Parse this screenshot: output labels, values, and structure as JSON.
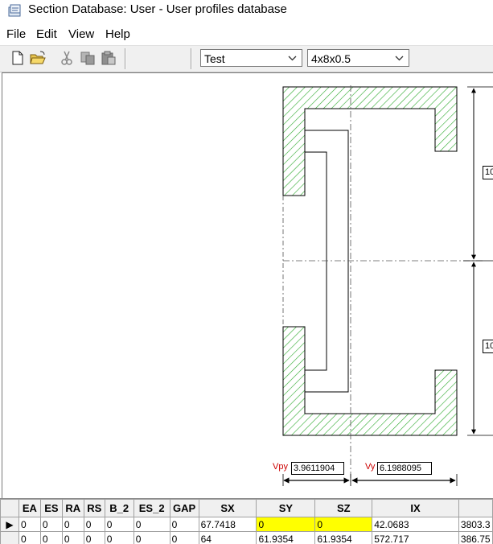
{
  "window": {
    "title": "Section Database: User - User profiles database"
  },
  "menu": {
    "file": "File",
    "edit": "Edit",
    "view": "View",
    "help": "Help"
  },
  "toolbar": {
    "profile_type": "Test",
    "section_name": "4x8x0.5",
    "icons": [
      "new-document-icon",
      "open-folder-icon",
      "cut-icon",
      "copy-icon",
      "paste-icon"
    ]
  },
  "drawing": {
    "vpy_label": "Vpy",
    "vpy_value": "3.9611904",
    "vy_label": "Vy",
    "vy_value": "6.1988095",
    "dim_upper": "10",
    "dim_lower": "10",
    "hatch_color": "#00aa00",
    "label_color": "#cc0000"
  },
  "table": {
    "columns": [
      "",
      "EA",
      "ES",
      "RA",
      "RS",
      "B_2",
      "ES_2",
      "GAP",
      "SX",
      "SY",
      "SZ",
      "IX",
      ""
    ],
    "rows": [
      {
        "indicator": "▶",
        "cells": [
          "0",
          "0",
          "0",
          "0",
          "0",
          "0",
          "0",
          "67.7418",
          "0",
          "0",
          "42.0683",
          "3803.3"
        ]
      },
      {
        "indicator": "",
        "cells": [
          "0",
          "0",
          "0",
          "0",
          "0",
          "0",
          "0",
          "64",
          "61.9354",
          "61.9354",
          "572.717",
          "386.75"
        ]
      }
    ],
    "highlight_color": "#ffff00"
  }
}
